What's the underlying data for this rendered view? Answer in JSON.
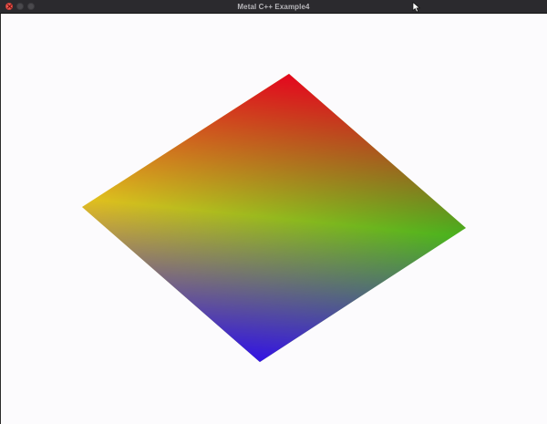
{
  "window": {
    "title": "Metal C++ Example4",
    "background_color": "#fcfbfd",
    "titlebar_color": "#2b2a2e"
  },
  "titlebar": {
    "close_icon": "close-icon",
    "minimize_icon": "minimize-icon",
    "zoom_icon": "zoom-icon"
  },
  "render": {
    "shape": "quad",
    "vertex_colors": {
      "top": "#ff0000",
      "right": "#33dd00",
      "bottom": "#1a10ff",
      "left": "#ffee00"
    }
  }
}
